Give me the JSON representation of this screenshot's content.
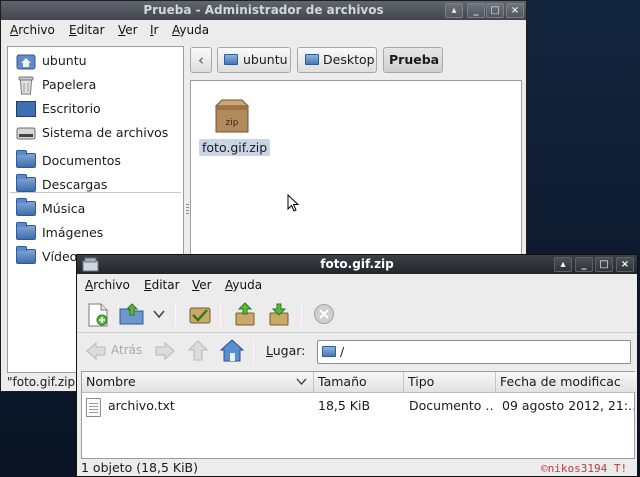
{
  "file_manager": {
    "title": "Prueba - Administrador de archivos",
    "menu": [
      {
        "first": "A",
        "rest": "rchivo"
      },
      {
        "first": "E",
        "rest": "ditar"
      },
      {
        "first": "V",
        "rest": "er"
      },
      {
        "first": "I",
        "rest": "r"
      },
      {
        "first": "A",
        "rest": "yuda"
      }
    ],
    "sidebar": {
      "places": [
        "ubuntu",
        "Papelera",
        "Escritorio",
        "Sistema de archivos"
      ],
      "bookmarks": [
        "Documentos",
        "Descargas",
        "Música",
        "Imágenes",
        "Vídeos"
      ]
    },
    "path": {
      "back": "‹",
      "crumbs": [
        "ubuntu",
        "Desktop",
        "Prueba"
      ]
    },
    "items": [
      {
        "name": "foto.gif.zip",
        "icon_label": "zip"
      }
    ],
    "status": "\"foto.gif.zip\""
  },
  "archive_manager": {
    "title": "foto.gif.zip",
    "menu": [
      {
        "first": "A",
        "rest": "rchivo"
      },
      {
        "first": "E",
        "rest": "ditar"
      },
      {
        "first": "V",
        "rest": "er"
      },
      {
        "first": "A",
        "rest": "yuda"
      }
    ],
    "nav": {
      "back": "Atrás"
    },
    "location": {
      "label_first": "L",
      "label_rest": "ugar:",
      "value": "/"
    },
    "columns": [
      "Nombre",
      "Tamaño",
      "Tipo",
      "Fecha de modificac"
    ],
    "rows": [
      {
        "name": "archivo.txt",
        "size": "18,5 KiB",
        "type": "Documento …",
        "date": "09 agosto 2012, 21:…"
      }
    ],
    "status": "1 objeto (18,5 KiB)"
  },
  "watermark": "©nikos3194 T!",
  "colors": {
    "selection": "#c9d5e6",
    "folder": "#4a78b6",
    "titlebar_active": "#22262b"
  }
}
